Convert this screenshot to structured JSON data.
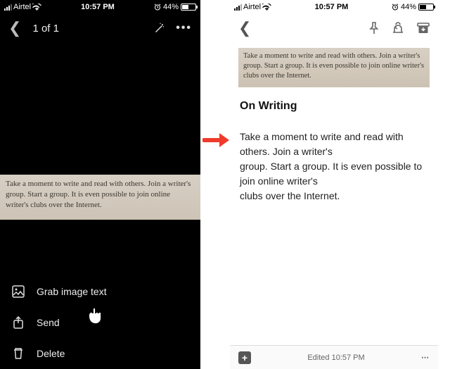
{
  "status": {
    "carrier": "Airtel",
    "time": "10:57 PM",
    "battery_pct": "44%",
    "alarm_icon": "alarm"
  },
  "left": {
    "counter": "1 of 1",
    "image_text": "Take a moment to write and read with others. Join a writer's group. Start a group. It is even possible to join online writer's clubs over the Internet.",
    "actions": {
      "grab": "Grab image text",
      "send": "Send",
      "delete": "Delete"
    }
  },
  "right": {
    "thumb_text": "Take a moment to write and read with others. Join a writer's group. Start a group. It is even possible to join online writer's clubs over the Internet.",
    "note_title": "On Writing",
    "note_body": "Take a moment to write and read with others. Join a writer's\ngroup. Start a group. It is even possible to join online writer's\nclubs over the Internet.",
    "footer_status": "Edited 10:57 PM"
  }
}
